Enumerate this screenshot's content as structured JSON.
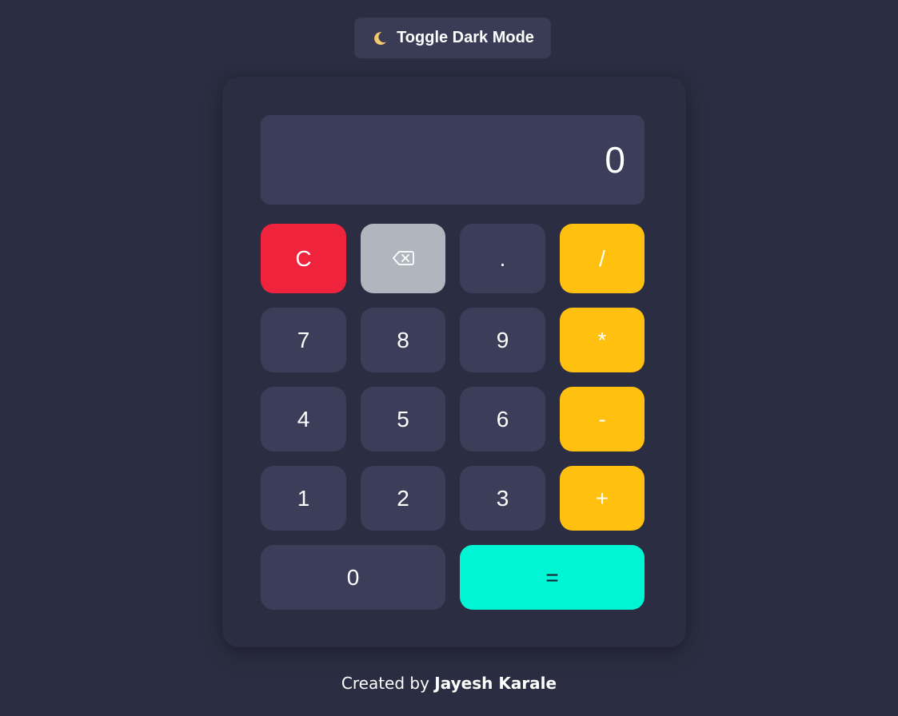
{
  "toggle": {
    "icon": "moon-icon",
    "label": "Toggle Dark Mode"
  },
  "display": {
    "value": "0"
  },
  "keys": {
    "clear": "C",
    "backspace_icon": "backspace-icon",
    "dot": ".",
    "divide": "/",
    "seven": "7",
    "eight": "8",
    "nine": "9",
    "multiply": "*",
    "four": "4",
    "five": "5",
    "six": "6",
    "minus": "-",
    "one": "1",
    "two": "2",
    "three": "3",
    "plus": "+",
    "zero": "0",
    "equals": "="
  },
  "footer": {
    "prefix": "Created by",
    "author": "Jayesh Karale"
  },
  "colors": {
    "background": "#2b2d42",
    "key": "#3c3d58",
    "operator": "#ffc010",
    "clear": "#ef233c",
    "backspace": "#b0b6bd",
    "equals": "#00f5d4"
  }
}
